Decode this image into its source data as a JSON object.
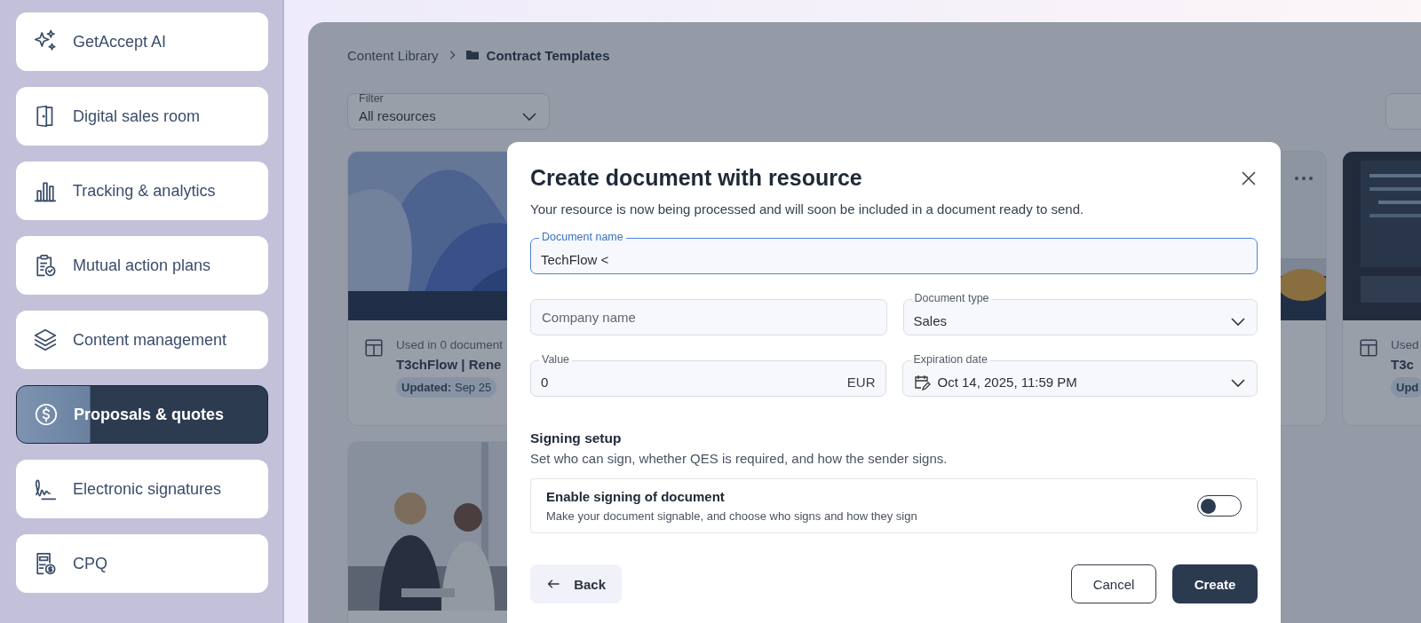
{
  "sidebar": {
    "items": [
      {
        "label": "GetAccept AI",
        "selected": false
      },
      {
        "label": "Digital sales room",
        "selected": false
      },
      {
        "label": "Tracking & analytics",
        "selected": false
      },
      {
        "label": "Mutual action plans",
        "selected": false
      },
      {
        "label": "Content management",
        "selected": false
      },
      {
        "label": "Proposals & quotes",
        "selected": true
      },
      {
        "label": "Electronic signatures",
        "selected": false
      },
      {
        "label": "CPQ",
        "selected": false
      }
    ]
  },
  "breadcrumb": [
    "Content Library",
    "Contract Templates"
  ],
  "filter": {
    "label": "Filter",
    "value": "All resources"
  },
  "cards": [
    {
      "kind": "waves",
      "used": "Used in 0 document",
      "title": "T3chFlow | Rene",
      "updated": "**Updated:** Sep 25"
    },
    {
      "kind": "room"
    },
    {
      "kind": "code",
      "used": "Used",
      "title": "T3c",
      "updated": "**Upd**"
    },
    {
      "kind": "people"
    }
  ],
  "modal": {
    "title": "Create document with resource",
    "subtitle": "Your resource is now being processed and will soon be included in a document ready to send.",
    "document_name": {
      "label": "Document name",
      "value": "TechFlow <",
      "focused": true
    },
    "company_name": {
      "placeholder": "Company name"
    },
    "document_type": {
      "label": "Document type",
      "value": "Sales"
    },
    "value": {
      "label": "Value",
      "value": "0",
      "currency": "EUR"
    },
    "expiration_date": {
      "label": "Expiration date",
      "value": "Oct 14, 2025, 11:59 PM"
    },
    "signing": {
      "title": "Signing setup",
      "subtitle": "Set who can sign, whether QES is required, and how the sender signs.",
      "toggle_title": "Enable signing of document",
      "toggle_subtitle": "Make your document signable, and choose who signs and how they sign",
      "enabled": false
    },
    "buttons": {
      "back": "Back",
      "cancel": "Cancel",
      "create": "Create"
    }
  }
}
